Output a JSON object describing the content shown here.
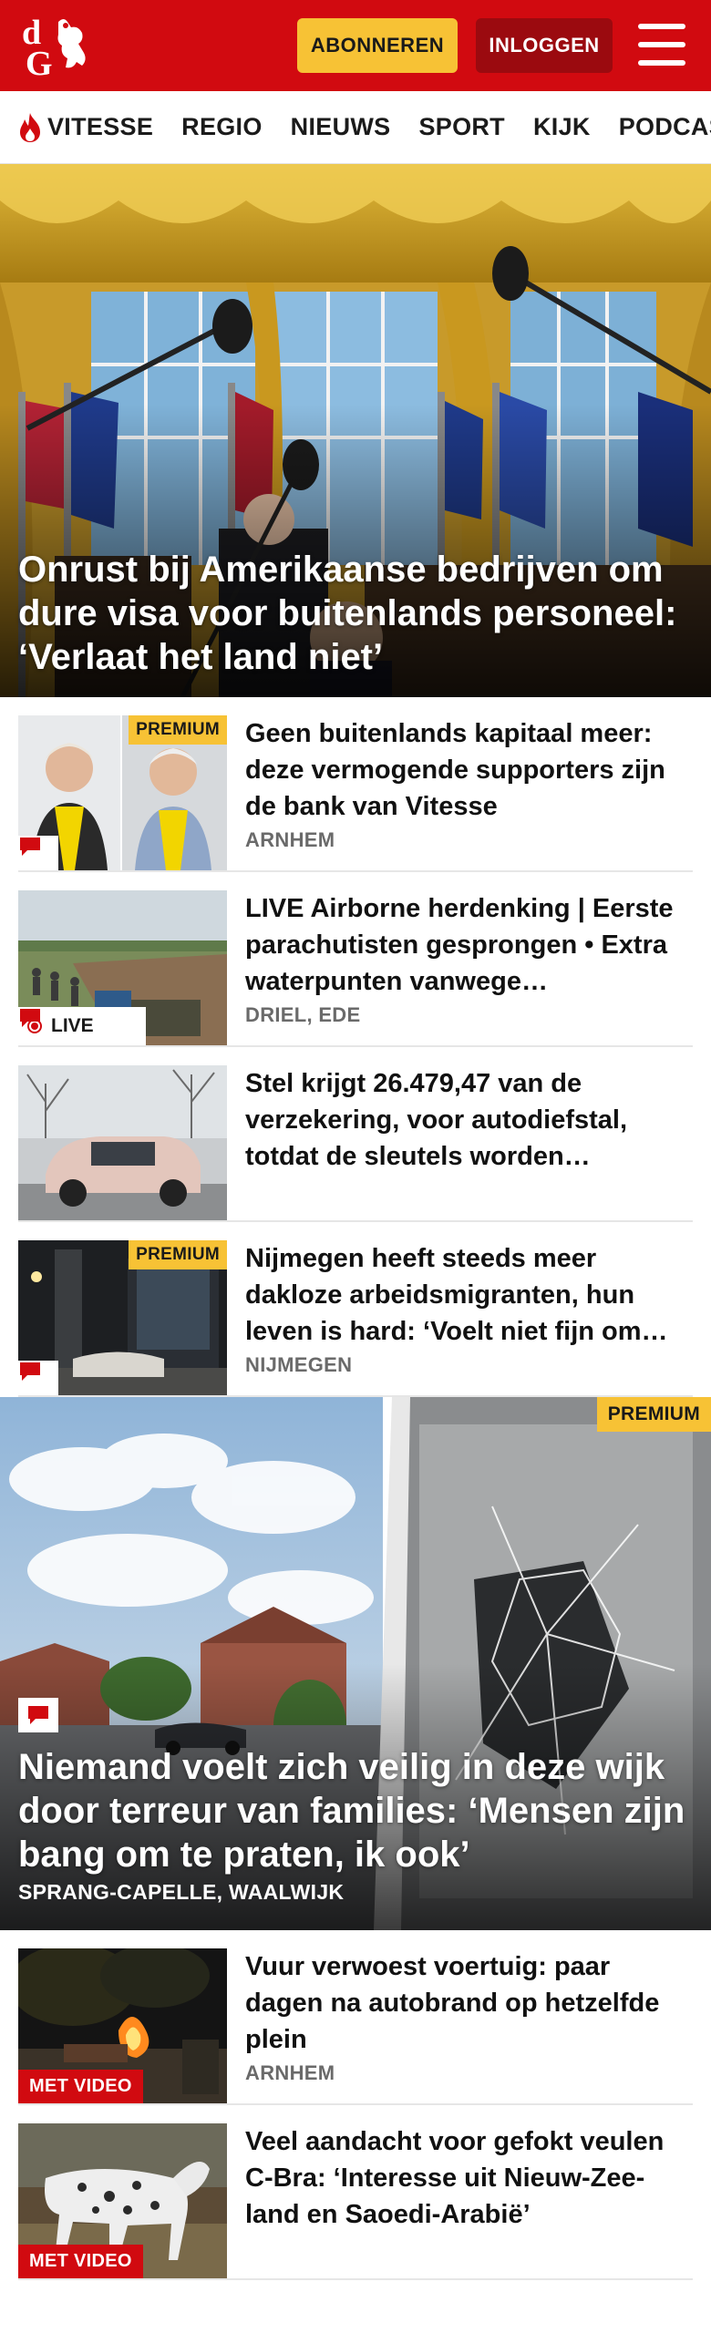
{
  "header": {
    "logo_text": "dG",
    "subscribe_label": "ABONNEREN",
    "login_label": "INLOGGEN",
    "brand_red": "#d10a10",
    "subscribe_color": "#f7c235"
  },
  "nav": {
    "items": [
      {
        "label": "VITESSE",
        "icon": "flame-icon"
      },
      {
        "label": "REGIO"
      },
      {
        "label": "NIEUWS"
      },
      {
        "label": "SPORT"
      },
      {
        "label": "KIJK"
      },
      {
        "label": "PODCAST"
      }
    ]
  },
  "hero": {
    "title": "Onrust bij Amerikaanse bedrijven om dure visa voor buitenlands personeel: ‘Verlaat het land niet’"
  },
  "articles": [
    {
      "title": "Geen buitenlands kapitaal meer: deze vermogende supporters zijn de bank van Vitesse",
      "location": "ARNHEM",
      "badge": "PREMIUM",
      "comments_icon": "comment-icon"
    },
    {
      "title": "LIVE Airborne herdenking | Eerste parachutisten gesprongen • Extra waterpunten vanwege…",
      "location": "DRIEL, EDE",
      "live_label": "LIVE",
      "comments_icon": "comment-icon"
    },
    {
      "title": "Stel krijgt 26.479,47 van de verzekering, voor autodiefstal, totdat de sleutels worden…",
      "location": ""
    },
    {
      "title": "Nijmegen heeft steeds meer dakloze arbeidsmigranten, hun leven is hard: ‘Voelt niet fijn om…",
      "location": "NIJMEGEN",
      "badge": "PREMIUM",
      "comments_icon": "comment-icon"
    }
  ],
  "feature": {
    "badge": "PREMIUM",
    "title": "Niemand voelt zich veilig in deze wijk door terreur van families: ‘Mensen zijn bang om te praten, ik ook’",
    "location": "SPRANG-CAPELLE, WAALWIJK"
  },
  "articles2": [
    {
      "title": "Vuur verwoest voertuig: paar dagen na autobrand op hetzelfde plein",
      "location": "ARNHEM",
      "video_label": "MET VIDEO"
    },
    {
      "title": "Veel aandacht voor gefokt veulen C-Bra: ‘Interesse uit Nieuw-Zee-land en Saoedi-Arabië’",
      "location": "",
      "video_label": "MET VIDEO"
    }
  ]
}
